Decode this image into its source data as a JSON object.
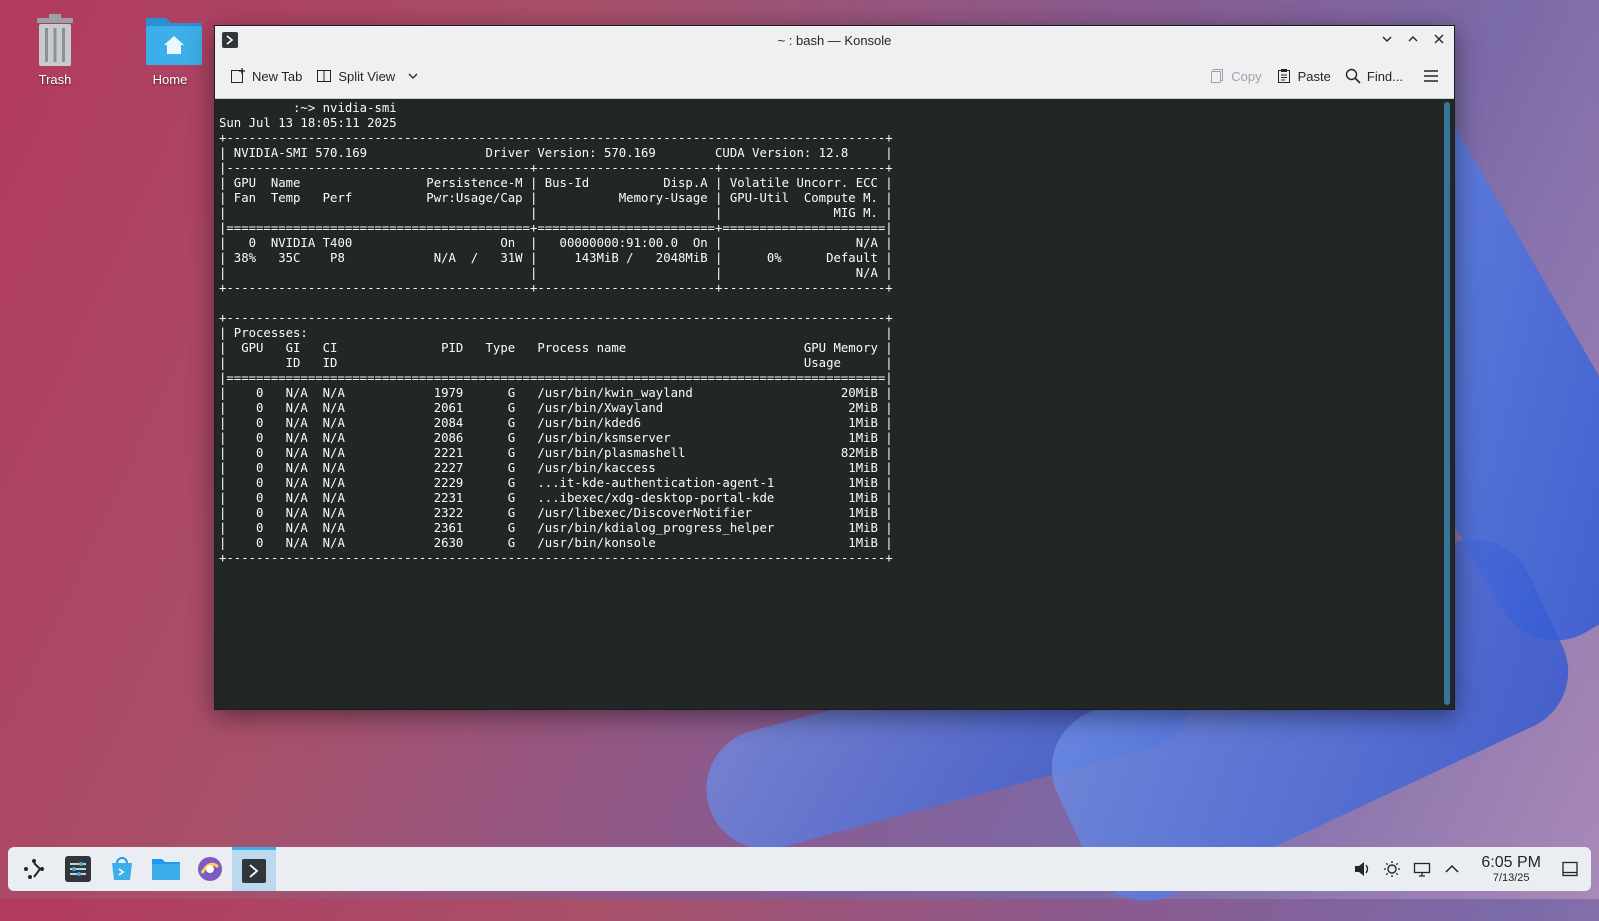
{
  "desktop": {
    "icons": [
      {
        "label": "Trash",
        "icon": "trash-icon"
      },
      {
        "label": "Home",
        "icon": "home-folder-icon"
      }
    ]
  },
  "window": {
    "title": "~ : bash — Konsole",
    "toolbar": {
      "new_tab": "New Tab",
      "split_view": "Split View",
      "copy": "Copy",
      "paste": "Paste",
      "find": "Find..."
    }
  },
  "terminal": {
    "lines": [
      "          :~> nvidia-smi",
      "Sun Jul 13 18:05:11 2025",
      "+-----------------------------------------------------------------------------------------+",
      "| NVIDIA-SMI 570.169                Driver Version: 570.169        CUDA Version: 12.8     |",
      "|-----------------------------------------+------------------------+----------------------+",
      "| GPU  Name                 Persistence-M | Bus-Id          Disp.A | Volatile Uncorr. ECC |",
      "| Fan  Temp   Perf          Pwr:Usage/Cap |           Memory-Usage | GPU-Util  Compute M. |",
      "|                                         |                        |               MIG M. |",
      "|=========================================+========================+======================|",
      "|   0  NVIDIA T400                    On  |   00000000:91:00.0  On |                  N/A |",
      "| 38%   35C    P8            N/A  /   31W |     143MiB /   2048MiB |      0%      Default |",
      "|                                         |                        |                  N/A |",
      "+-----------------------------------------+------------------------+----------------------+",
      "",
      "+-----------------------------------------------------------------------------------------+",
      "| Processes:                                                                              |",
      "|  GPU   GI   CI              PID   Type   Process name                        GPU Memory |",
      "|        ID   ID                                                               Usage      |",
      "|=========================================================================================|",
      "|    0   N/A  N/A            1979      G   /usr/bin/kwin_wayland                    20MiB |",
      "|    0   N/A  N/A            2061      G   /usr/bin/Xwayland                         2MiB |",
      "|    0   N/A  N/A            2084      G   /usr/bin/kded6                            1MiB |",
      "|    0   N/A  N/A            2086      G   /usr/bin/ksmserver                        1MiB |",
      "|    0   N/A  N/A            2221      G   /usr/bin/plasmashell                     82MiB |",
      "|    0   N/A  N/A            2227      G   /usr/bin/kaccess                          1MiB |",
      "|    0   N/A  N/A            2229      G   ...it-kde-authentication-agent-1          1MiB |",
      "|    0   N/A  N/A            2231      G   ...ibexec/xdg-desktop-portal-kde          1MiB |",
      "|    0   N/A  N/A            2322      G   /usr/libexec/DiscoverNotifier             1MiB |",
      "|    0   N/A  N/A            2361      G   /usr/bin/kdialog_progress_helper          1MiB |",
      "|    0   N/A  N/A            2630      G   /usr/bin/konsole                          1MiB |",
      "+-----------------------------------------------------------------------------------------+"
    ]
  },
  "taskbar": {
    "items": [
      {
        "name": "application-launcher",
        "icon": "kde-launcher-icon"
      },
      {
        "name": "system-settings",
        "icon": "settings-icon"
      },
      {
        "name": "discover",
        "icon": "store-icon"
      },
      {
        "name": "dolphin",
        "icon": "folder-icon"
      },
      {
        "name": "browser",
        "icon": "browser-icon"
      },
      {
        "name": "konsole",
        "icon": "terminal-icon",
        "active": true
      }
    ],
    "clock": {
      "time": "6:05 PM",
      "date": "7/13/25"
    }
  }
}
